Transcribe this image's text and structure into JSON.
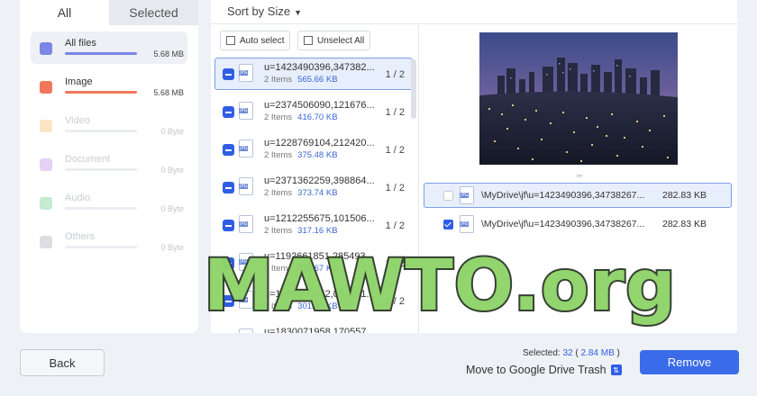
{
  "tabs": {
    "all": "All",
    "selected": "Selected"
  },
  "categories": [
    {
      "name": "All files",
      "size": "5.68 MB",
      "color": "#7b86e6",
      "fill_pct": 100,
      "icon": "folder-icon"
    },
    {
      "name": "Image",
      "size": "5.68 MB",
      "color": "#f0775a",
      "fill_pct": 100,
      "icon": "image-icon"
    },
    {
      "name": "Video",
      "size": "0 Byte",
      "color": "#f5b45a",
      "fill_pct": 0,
      "icon": "video-icon"
    },
    {
      "name": "Document",
      "size": "0 Byte",
      "color": "#b67ae6",
      "fill_pct": 0,
      "icon": "document-icon"
    },
    {
      "name": "Audio",
      "size": "0 Byte",
      "color": "#5ac57a",
      "fill_pct": 0,
      "icon": "audio-icon"
    },
    {
      "name": "Others",
      "size": "0 Byte",
      "color": "#9aa0ab",
      "fill_pct": 0,
      "icon": "others-icon"
    }
  ],
  "sort": {
    "label": "Sort by Size"
  },
  "actions": {
    "auto_select": "Auto select",
    "unselect_all": "Unselect All"
  },
  "groups": [
    {
      "name": "u=1423490396,347382...",
      "items": "2 Items",
      "size": "565.66 KB",
      "count": "1 / 2"
    },
    {
      "name": "u=2374506090,121676...",
      "items": "2 Items",
      "size": "416.70 KB",
      "count": "1 / 2"
    },
    {
      "name": "u=1228769104,212420...",
      "items": "2 Items",
      "size": "375.48 KB",
      "count": "1 / 2"
    },
    {
      "name": "u=2371362259,398864...",
      "items": "2 Items",
      "size": "373.74 KB",
      "count": "1 / 2"
    },
    {
      "name": "u=1212255675,101506...",
      "items": "2 Items",
      "size": "317.16 KB",
      "count": "1 / 2"
    },
    {
      "name": "u=1192661851,285493...",
      "items": "2 Items",
      "size": "309.67 KB",
      "count": "1 / 2"
    },
    {
      "name": "u=1066868942,052391...",
      "items": "2 Items",
      "size": "301.40 KB",
      "count": "1 / 2"
    },
    {
      "name": "u=1830071958,170557...",
      "items": "",
      "size": "",
      "count": ""
    }
  ],
  "duplicates": [
    {
      "path": "\\MyDrive\\jf\\u=1423490396,34738267...",
      "size": "282.83 KB",
      "checked": false
    },
    {
      "path": "\\MyDrive\\jf\\u=1423490396,34738267...",
      "size": "282.83 KB",
      "checked": true
    }
  ],
  "footer": {
    "back": "Back",
    "selected_label": "Selected:",
    "selected_count": "32",
    "selected_size": "2.84 MB",
    "move_to": "Move to Google Drive Trash",
    "remove": "Remove"
  },
  "watermark": "MAWTO.org"
}
